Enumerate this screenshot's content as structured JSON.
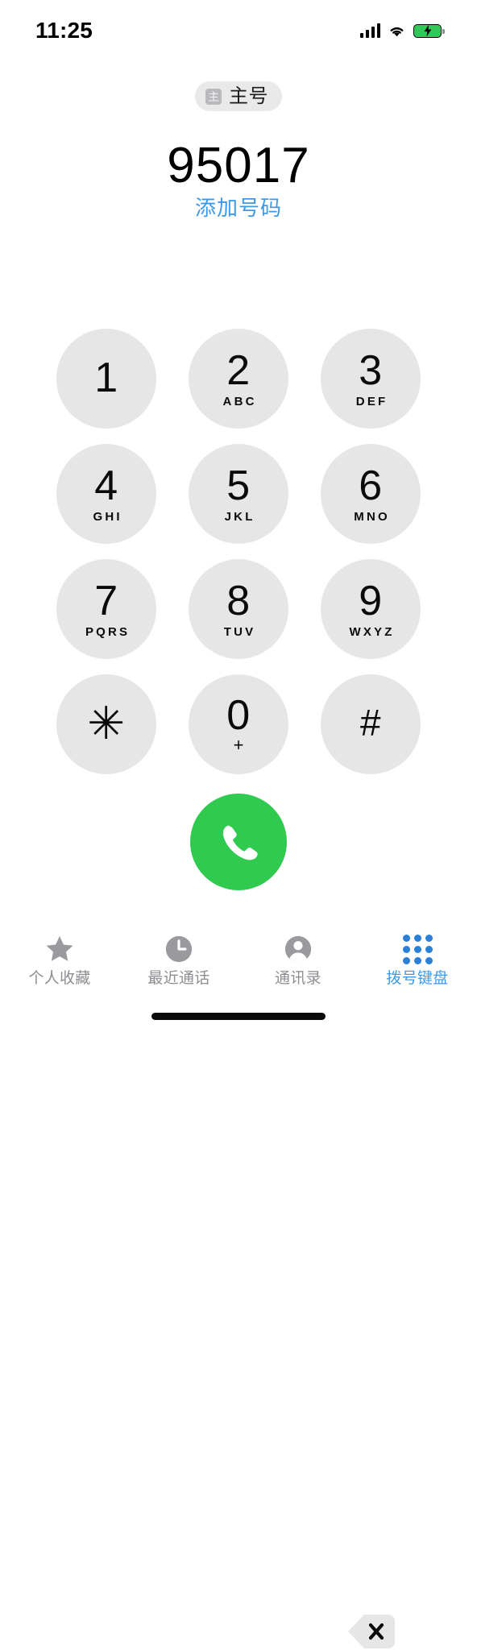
{
  "status_bar": {
    "time": "11:25",
    "signal_icon": "cellular-signal-icon",
    "wifi_icon": "wifi-icon",
    "battery_icon": "battery-charging-icon",
    "battery_color": "#33c759"
  },
  "sim_badge": {
    "icon": "sim-card-icon",
    "icon_glyph": "主",
    "label": "主号"
  },
  "number": {
    "value": "95017",
    "add_number_label": "添加号码",
    "link_color": "#3d9ae8"
  },
  "keypad": {
    "keys": [
      {
        "digit": "1",
        "letters": "",
        "name": "key-1"
      },
      {
        "digit": "2",
        "letters": "ABC",
        "name": "key-2"
      },
      {
        "digit": "3",
        "letters": "DEF",
        "name": "key-3"
      },
      {
        "digit": "4",
        "letters": "GHI",
        "name": "key-4"
      },
      {
        "digit": "5",
        "letters": "JKL",
        "name": "key-5"
      },
      {
        "digit": "6",
        "letters": "MNO",
        "name": "key-6"
      },
      {
        "digit": "7",
        "letters": "PQRS",
        "name": "key-7"
      },
      {
        "digit": "8",
        "letters": "TUV",
        "name": "key-8"
      },
      {
        "digit": "9",
        "letters": "WXYZ",
        "name": "key-9"
      },
      {
        "digit": "✳",
        "letters": "",
        "name": "key-star"
      },
      {
        "digit": "0",
        "letters": "+",
        "name": "key-0"
      },
      {
        "digit": "#",
        "letters": "",
        "name": "key-hash"
      }
    ],
    "button_color": "#e6e6e6"
  },
  "actions": {
    "call_icon": "phone-handset-icon",
    "call_color": "#31ca51",
    "delete_icon": "backspace-delete-icon"
  },
  "tab_bar": {
    "tabs": [
      {
        "label": "个人收藏",
        "icon": "star-icon",
        "active": false
      },
      {
        "label": "最近通话",
        "icon": "clock-icon",
        "active": false
      },
      {
        "label": "通讯录",
        "icon": "person-circle-icon",
        "active": false
      },
      {
        "label": "拨号键盘",
        "icon": "keypad-grid-icon",
        "active": true
      }
    ],
    "active_color": "#3d9ae8",
    "inactive_color": "#8e8e93"
  }
}
